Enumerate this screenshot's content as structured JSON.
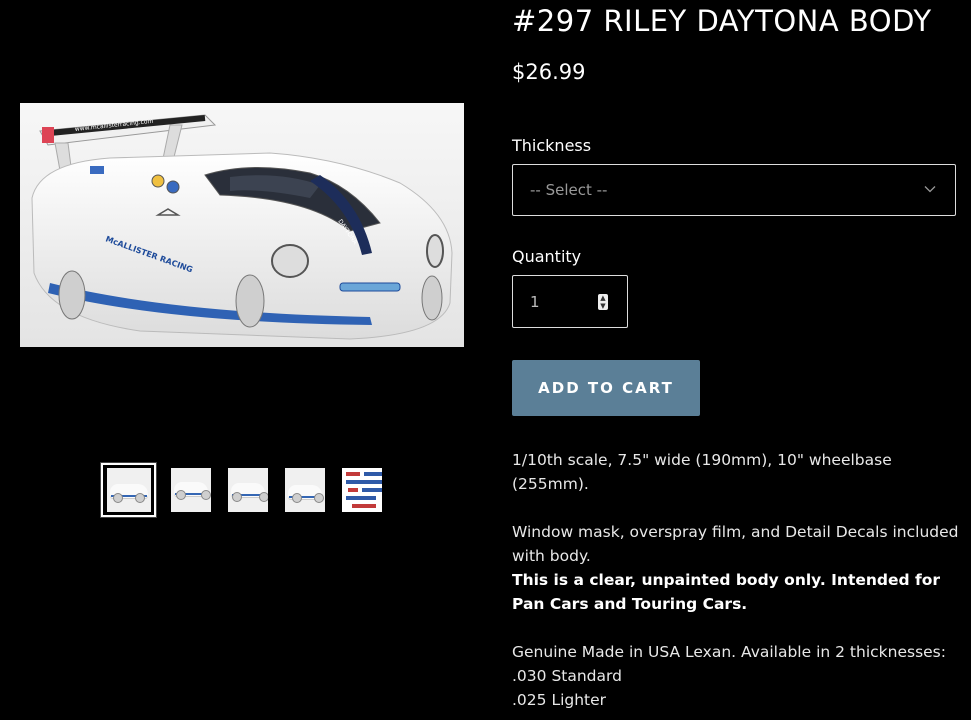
{
  "product": {
    "title": "#297 RILEY DAYTONA BODY",
    "price": "$26.99",
    "main_image_alt": "White Riley Daytona RC body with blue stripes"
  },
  "gallery": {
    "thumbnails": [
      "thumb-1",
      "thumb-2",
      "thumb-3",
      "thumb-4",
      "thumb-5"
    ],
    "active_index": 0
  },
  "options": {
    "thickness_label": "Thickness",
    "thickness_value": "-- Select --",
    "quantity_label": "Quantity",
    "quantity_value": "1"
  },
  "cart": {
    "add_label": "ADD TO CART",
    "button_color": "#5b7f97"
  },
  "description": {
    "line1": " 1/10th scale, 7.5\" wide (190mm), 10\" wheelbase (255mm).",
    "line2": "Window mask, overspray film, and Detail Decals included with body.",
    "line3_bold": "This is a clear, unpainted body only. Intended for Pan Cars and Touring Cars.",
    "line4": "Genuine Made in USA Lexan. Available in 2 thicknesses:",
    "line5": ".030 Standard",
    "line6": ".025 Lighter"
  },
  "main_image_decals": {
    "website": "www.mcallisterracing.com",
    "side_text": "McALLISTER RACING",
    "model": "DAYTONA"
  },
  "icons": {
    "chevron": "chevron-down-icon",
    "stepper": "stepper-icon"
  }
}
